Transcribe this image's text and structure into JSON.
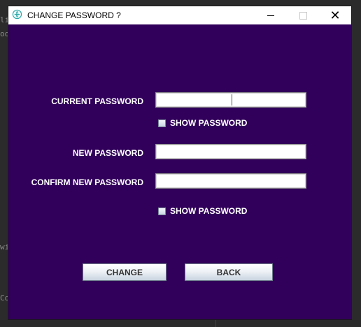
{
  "background": {
    "code_fragments": [
      "li",
      "oo",
      "wi",
      "Co"
    ]
  },
  "window": {
    "title": "CHANGE PASSWORD ?",
    "icon": "app-globe-icon",
    "controls": {
      "minimize": "minimize-icon",
      "maximize": "maximize-icon",
      "close": "✕"
    }
  },
  "form": {
    "current_password_label": "CURRENT PASSWORD",
    "current_password_value": "",
    "show_password_1": "SHOW PASSWORD",
    "new_password_label": "NEW PASSWORD",
    "new_password_value": "",
    "confirm_password_label": "CONFIRM NEW PASSWORD",
    "confirm_password_value": "",
    "show_password_2": "SHOW PASSWORD"
  },
  "buttons": {
    "change": "CHANGE",
    "back": "BACK"
  },
  "colors": {
    "window_background": "#31005a",
    "titlebar": "#ffffff",
    "label_text": "#ffffff"
  }
}
